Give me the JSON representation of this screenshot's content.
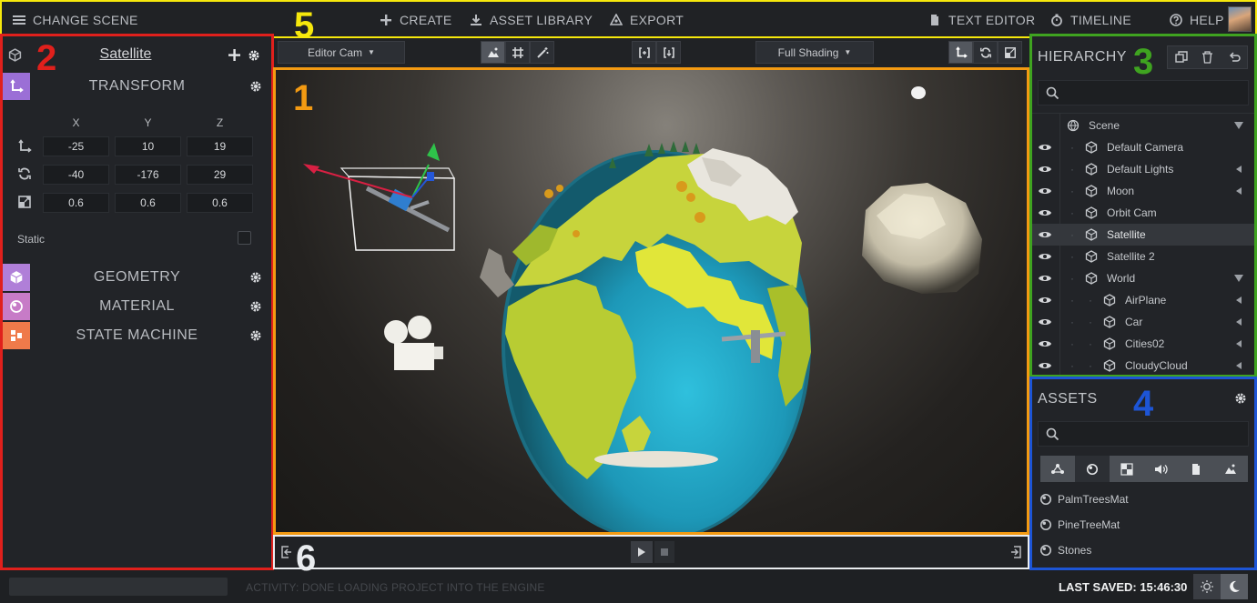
{
  "topbar": {
    "change_scene": "CHANGE SCENE",
    "create": "CREATE",
    "asset_library": "ASSET LIBRARY",
    "export": "EXPORT",
    "text_editor": "TEXT EDITOR",
    "timeline": "TIMELINE",
    "help": "HELP"
  },
  "annotations": {
    "n1": "1",
    "n2": "2",
    "n3": "3",
    "n4": "4",
    "n5": "5",
    "n6": "6"
  },
  "annotation_colors": {
    "n1": "#f39a12",
    "n2": "#e0201c",
    "n3": "#3fa320",
    "n4": "#1d55d6",
    "n5": "#f6e80c",
    "n6": "#e9ecef"
  },
  "inspector": {
    "entity_name": "Satellite",
    "transform": {
      "title": "TRANSFORM",
      "axes": [
        "X",
        "Y",
        "Z"
      ],
      "position": [
        "-25",
        "10",
        "19"
      ],
      "rotation": [
        "-40",
        "-176",
        "29"
      ],
      "scale": [
        "0.6",
        "0.6",
        "0.6"
      ]
    },
    "static_label": "Static",
    "geometry": "GEOMETRY",
    "material": "MATERIAL",
    "state_machine": "STATE MACHINE",
    "section_colors": {
      "transform": "#9b6fd6",
      "geometry": "#b07fd8",
      "material": "#c77bc7",
      "state_machine": "#ef7a4a"
    }
  },
  "viewport_toolbar": {
    "camera": "Editor Cam",
    "shading": "Full Shading"
  },
  "hierarchy": {
    "title": "HIERARCHY",
    "items": [
      {
        "label": "Scene"
      },
      {
        "label": "Default Camera"
      },
      {
        "label": "Default Lights"
      },
      {
        "label": "Moon"
      },
      {
        "label": "Orbit Cam"
      },
      {
        "label": "Satellite"
      },
      {
        "label": "Satellite 2"
      },
      {
        "label": "World"
      },
      {
        "label": "AirPlane"
      },
      {
        "label": "Car"
      },
      {
        "label": "Cities02"
      },
      {
        "label": "CloudyCloud"
      }
    ]
  },
  "assets": {
    "title": "ASSETS",
    "items": [
      {
        "label": "PalmTreesMat"
      },
      {
        "label": "PineTreeMat"
      },
      {
        "label": "Stones"
      }
    ]
  },
  "status": {
    "activity": "ACTIVITY: DONE LOADING PROJECT INTO THE ENGINE",
    "last_saved": "LAST SAVED: 15:46:30"
  }
}
